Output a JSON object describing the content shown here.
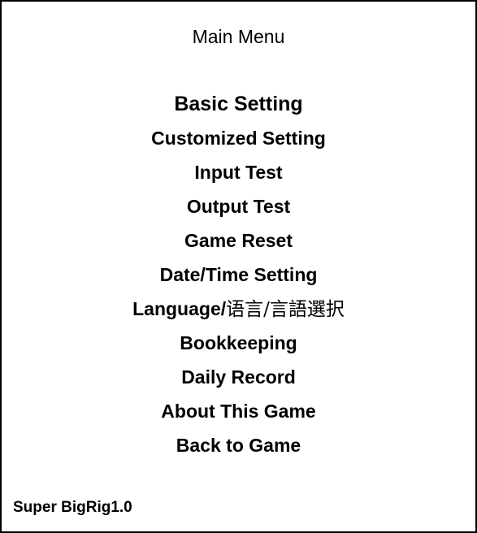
{
  "title": "Main Menu",
  "menu": {
    "items": [
      {
        "label": "Basic Setting"
      },
      {
        "label": "Customized Setting"
      },
      {
        "label": "Input Test"
      },
      {
        "label": "Output Test"
      },
      {
        "label": "Game Reset"
      },
      {
        "label": "Date/Time Setting"
      },
      {
        "label": "Language/",
        "label_cjk": "语言/言語選択"
      },
      {
        "label": "Bookkeeping"
      },
      {
        "label": "Daily Record"
      },
      {
        "label": "About This Game"
      },
      {
        "label": "Back to Game"
      }
    ],
    "selected_index": 0
  },
  "footer": {
    "version": "Super BigRig1.0"
  },
  "colors": {
    "background": "#ffffff",
    "text": "#000000",
    "border": "#000000"
  }
}
